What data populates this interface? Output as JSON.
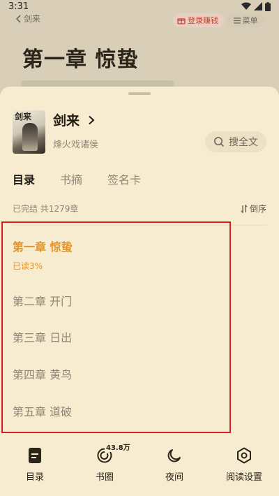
{
  "status_bar": {
    "time": "3:31"
  },
  "topbar": {
    "back_label": "剑来",
    "earn_label": "登录赚钱",
    "menu_label": "菜单"
  },
  "background": {
    "chapter_heading": "第一章 惊蛰"
  },
  "book": {
    "cover_caption": "剑来",
    "title": "剑来",
    "author": "烽火戏诸侯"
  },
  "search": {
    "label": "搜全文"
  },
  "tabs": [
    {
      "label": "目录",
      "active": true
    },
    {
      "label": "书摘",
      "active": false
    },
    {
      "label": "签名卡",
      "active": false
    }
  ],
  "catalog": {
    "status": "已完结 共1279章",
    "sort_label": "倒序"
  },
  "chapters": [
    {
      "title": "第一章 惊蛰",
      "current": true,
      "progress": "已读3%"
    },
    {
      "title": "第二章 开门",
      "current": false
    },
    {
      "title": "第三章 日出",
      "current": false
    },
    {
      "title": "第四章 黄鸟",
      "current": false
    },
    {
      "title": "第五章 道破",
      "current": false
    }
  ],
  "bottom_nav": [
    {
      "label": "目录",
      "icon": "catalog-icon"
    },
    {
      "label": "书圈",
      "icon": "circle-icon",
      "badge": "43.8万"
    },
    {
      "label": "夜间",
      "icon": "moon-icon"
    },
    {
      "label": "阅读设置",
      "icon": "settings-icon"
    }
  ],
  "colors": {
    "accent": "#e2932a",
    "sheet_bg": "#f8ecd0",
    "highlight": "#d42020"
  }
}
